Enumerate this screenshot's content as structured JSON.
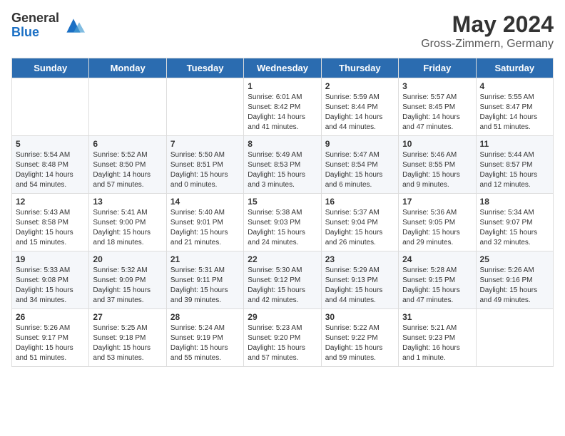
{
  "logo": {
    "general": "General",
    "blue": "Blue"
  },
  "title": {
    "month_year": "May 2024",
    "location": "Gross-Zimmern, Germany"
  },
  "calendar": {
    "headers": [
      "Sunday",
      "Monday",
      "Tuesday",
      "Wednesday",
      "Thursday",
      "Friday",
      "Saturday"
    ],
    "weeks": [
      [
        {
          "day": "",
          "info": ""
        },
        {
          "day": "",
          "info": ""
        },
        {
          "day": "",
          "info": ""
        },
        {
          "day": "1",
          "info": "Sunrise: 6:01 AM\nSunset: 8:42 PM\nDaylight: 14 hours\nand 41 minutes."
        },
        {
          "day": "2",
          "info": "Sunrise: 5:59 AM\nSunset: 8:44 PM\nDaylight: 14 hours\nand 44 minutes."
        },
        {
          "day": "3",
          "info": "Sunrise: 5:57 AM\nSunset: 8:45 PM\nDaylight: 14 hours\nand 47 minutes."
        },
        {
          "day": "4",
          "info": "Sunrise: 5:55 AM\nSunset: 8:47 PM\nDaylight: 14 hours\nand 51 minutes."
        }
      ],
      [
        {
          "day": "5",
          "info": "Sunrise: 5:54 AM\nSunset: 8:48 PM\nDaylight: 14 hours\nand 54 minutes."
        },
        {
          "day": "6",
          "info": "Sunrise: 5:52 AM\nSunset: 8:50 PM\nDaylight: 14 hours\nand 57 minutes."
        },
        {
          "day": "7",
          "info": "Sunrise: 5:50 AM\nSunset: 8:51 PM\nDaylight: 15 hours\nand 0 minutes."
        },
        {
          "day": "8",
          "info": "Sunrise: 5:49 AM\nSunset: 8:53 PM\nDaylight: 15 hours\nand 3 minutes."
        },
        {
          "day": "9",
          "info": "Sunrise: 5:47 AM\nSunset: 8:54 PM\nDaylight: 15 hours\nand 6 minutes."
        },
        {
          "day": "10",
          "info": "Sunrise: 5:46 AM\nSunset: 8:55 PM\nDaylight: 15 hours\nand 9 minutes."
        },
        {
          "day": "11",
          "info": "Sunrise: 5:44 AM\nSunset: 8:57 PM\nDaylight: 15 hours\nand 12 minutes."
        }
      ],
      [
        {
          "day": "12",
          "info": "Sunrise: 5:43 AM\nSunset: 8:58 PM\nDaylight: 15 hours\nand 15 minutes."
        },
        {
          "day": "13",
          "info": "Sunrise: 5:41 AM\nSunset: 9:00 PM\nDaylight: 15 hours\nand 18 minutes."
        },
        {
          "day": "14",
          "info": "Sunrise: 5:40 AM\nSunset: 9:01 PM\nDaylight: 15 hours\nand 21 minutes."
        },
        {
          "day": "15",
          "info": "Sunrise: 5:38 AM\nSunset: 9:03 PM\nDaylight: 15 hours\nand 24 minutes."
        },
        {
          "day": "16",
          "info": "Sunrise: 5:37 AM\nSunset: 9:04 PM\nDaylight: 15 hours\nand 26 minutes."
        },
        {
          "day": "17",
          "info": "Sunrise: 5:36 AM\nSunset: 9:05 PM\nDaylight: 15 hours\nand 29 minutes."
        },
        {
          "day": "18",
          "info": "Sunrise: 5:34 AM\nSunset: 9:07 PM\nDaylight: 15 hours\nand 32 minutes."
        }
      ],
      [
        {
          "day": "19",
          "info": "Sunrise: 5:33 AM\nSunset: 9:08 PM\nDaylight: 15 hours\nand 34 minutes."
        },
        {
          "day": "20",
          "info": "Sunrise: 5:32 AM\nSunset: 9:09 PM\nDaylight: 15 hours\nand 37 minutes."
        },
        {
          "day": "21",
          "info": "Sunrise: 5:31 AM\nSunset: 9:11 PM\nDaylight: 15 hours\nand 39 minutes."
        },
        {
          "day": "22",
          "info": "Sunrise: 5:30 AM\nSunset: 9:12 PM\nDaylight: 15 hours\nand 42 minutes."
        },
        {
          "day": "23",
          "info": "Sunrise: 5:29 AM\nSunset: 9:13 PM\nDaylight: 15 hours\nand 44 minutes."
        },
        {
          "day": "24",
          "info": "Sunrise: 5:28 AM\nSunset: 9:15 PM\nDaylight: 15 hours\nand 47 minutes."
        },
        {
          "day": "25",
          "info": "Sunrise: 5:26 AM\nSunset: 9:16 PM\nDaylight: 15 hours\nand 49 minutes."
        }
      ],
      [
        {
          "day": "26",
          "info": "Sunrise: 5:26 AM\nSunset: 9:17 PM\nDaylight: 15 hours\nand 51 minutes."
        },
        {
          "day": "27",
          "info": "Sunrise: 5:25 AM\nSunset: 9:18 PM\nDaylight: 15 hours\nand 53 minutes."
        },
        {
          "day": "28",
          "info": "Sunrise: 5:24 AM\nSunset: 9:19 PM\nDaylight: 15 hours\nand 55 minutes."
        },
        {
          "day": "29",
          "info": "Sunrise: 5:23 AM\nSunset: 9:20 PM\nDaylight: 15 hours\nand 57 minutes."
        },
        {
          "day": "30",
          "info": "Sunrise: 5:22 AM\nSunset: 9:22 PM\nDaylight: 15 hours\nand 59 minutes."
        },
        {
          "day": "31",
          "info": "Sunrise: 5:21 AM\nSunset: 9:23 PM\nDaylight: 16 hours\nand 1 minute."
        },
        {
          "day": "",
          "info": ""
        }
      ]
    ]
  }
}
